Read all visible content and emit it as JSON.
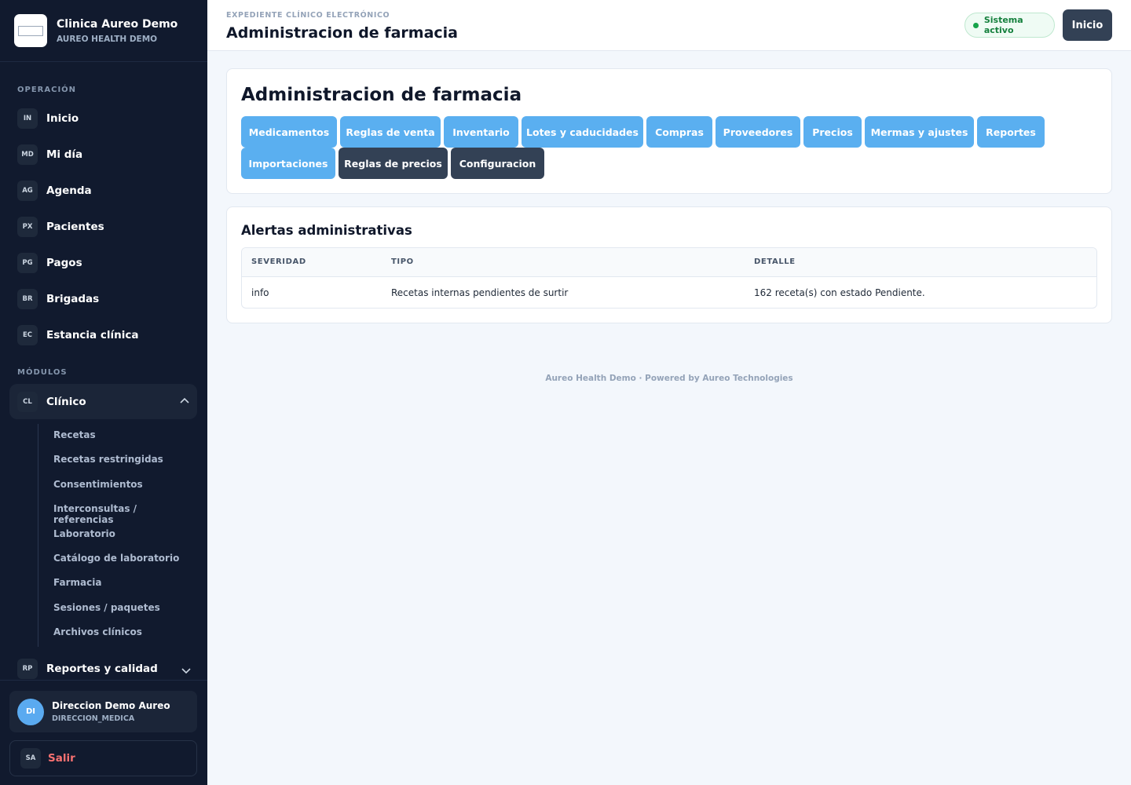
{
  "brand": {
    "name": "Clinica Aureo Demo",
    "subtitle": "AUREO HEALTH DEMO"
  },
  "sidebar": {
    "section_operation": "OPERACIÓN",
    "section_modules": "MÓDULOS",
    "items": [
      {
        "badge": "IN",
        "label": "Inicio"
      },
      {
        "badge": "MD",
        "label": "Mi día"
      },
      {
        "badge": "AG",
        "label": "Agenda"
      },
      {
        "badge": "PX",
        "label": "Pacientes"
      },
      {
        "badge": "PG",
        "label": "Pagos"
      },
      {
        "badge": "BR",
        "label": "Brigadas"
      },
      {
        "badge": "EC",
        "label": "Estancia clínica"
      }
    ],
    "modules": [
      {
        "badge": "CL",
        "label": "Clínico",
        "expanded": true
      },
      {
        "badge": "RP",
        "label": "Reportes y calidad",
        "expanded": false
      }
    ],
    "clinico_items": [
      "Recetas",
      "Recetas restringidas",
      "Consentimientos",
      "Interconsultas / referencias",
      "Laboratorio",
      "Catálogo de laboratorio",
      "Farmacia",
      "Sesiones / paquetes",
      "Archivos clínicos"
    ],
    "user": {
      "initials": "DI",
      "name": "Direccion Demo Aureo",
      "role": "DIRECCION_MEDICA"
    },
    "logout": {
      "badge": "SA",
      "label": "Salir"
    }
  },
  "header": {
    "eyebrow": "EXPEDIENTE CLÍNICO ELECTRÓNICO",
    "title": "Administracion de farmacia",
    "status": "Sistema activo",
    "home_button": "Inicio"
  },
  "pharmacy": {
    "title": "Administracion de farmacia",
    "tabs": [
      {
        "label": "Medicamentos",
        "style": "light"
      },
      {
        "label": "Reglas de venta",
        "style": "light"
      },
      {
        "label": "Inventario",
        "style": "light"
      },
      {
        "label": "Lotes y caducidades",
        "style": "light"
      },
      {
        "label": "Compras",
        "style": "light"
      },
      {
        "label": "Proveedores",
        "style": "light"
      },
      {
        "label": "Precios",
        "style": "light"
      },
      {
        "label": "Mermas y ajustes",
        "style": "light"
      },
      {
        "label": "Reportes",
        "style": "light"
      },
      {
        "label": "Importaciones",
        "style": "light"
      },
      {
        "label": "Reglas de precios",
        "style": "dark"
      },
      {
        "label": "Configuracion",
        "style": "dark"
      }
    ]
  },
  "alerts": {
    "title": "Alertas administrativas",
    "columns": [
      "SEVERIDAD",
      "TIPO",
      "DETALLE"
    ],
    "rows": [
      [
        "info",
        "Recetas internas pendientes de surtir",
        "162 receta(s) con estado Pendiente."
      ]
    ]
  },
  "footer": "Aureo Health Demo · Powered by Aureo Technologies",
  "colors": {
    "sidebar_bg": "#111a2e",
    "primary_tab": "#5aaff0",
    "dark_tab": "#334155",
    "status_green": "#16a34a",
    "logout_red": "#f87171"
  }
}
